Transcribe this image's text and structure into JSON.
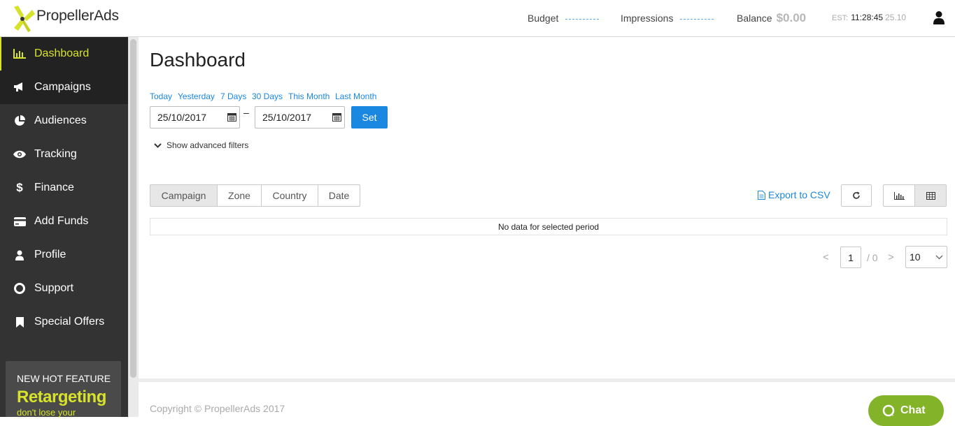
{
  "header": {
    "brand": "PropellerAds",
    "budget_label": "Budget",
    "impressions_label": "Impressions",
    "balance_label": "Balance",
    "balance_value": "$0.00",
    "est_label": "EST:",
    "time": "11:28:45",
    "date": "25.10"
  },
  "sidebar": {
    "items": [
      {
        "label": "Dashboard",
        "icon": "bar-chart-icon"
      },
      {
        "label": "Campaigns",
        "icon": "megaphone-icon"
      },
      {
        "label": "Audiences",
        "icon": "pie-chart-icon"
      },
      {
        "label": "Tracking",
        "icon": "eye-icon"
      },
      {
        "label": "Finance",
        "icon": "dollar-icon"
      },
      {
        "label": "Add Funds",
        "icon": "credit-card-icon"
      },
      {
        "label": "Profile",
        "icon": "user-icon"
      },
      {
        "label": "Support",
        "icon": "lifebuoy-icon"
      },
      {
        "label": "Special Offers",
        "icon": "bookmark-icon"
      }
    ],
    "promo": {
      "line1": "NEW HOT FEATURE",
      "line2": "Retargeting",
      "line3": "don't lose your"
    }
  },
  "main": {
    "title": "Dashboard",
    "quick_ranges": [
      "Today",
      "Yesterday",
      "7 Days",
      "30 Days",
      "This Month",
      "Last Month"
    ],
    "date_from": "25/10/2017",
    "date_sep": "–",
    "date_to": "25/10/2017",
    "set_label": "Set",
    "advanced_filters": "Show advanced filters",
    "group_tabs": [
      "Campaign",
      "Zone",
      "Country",
      "Date"
    ],
    "export_label": "Export to CSV",
    "no_data": "No data for selected period",
    "pager": {
      "prev": "<",
      "page": "1",
      "of": "/ 0",
      "next": ">",
      "per_page": "10"
    }
  },
  "footer": {
    "copyright": "Copyright © PropellerAds 2017",
    "chat": "Chat"
  },
  "colors": {
    "accent": "#1a87e0",
    "brand_yellow": "#d7e22b",
    "sidebar_bg": "#333333",
    "chat_green": "#83b329"
  }
}
